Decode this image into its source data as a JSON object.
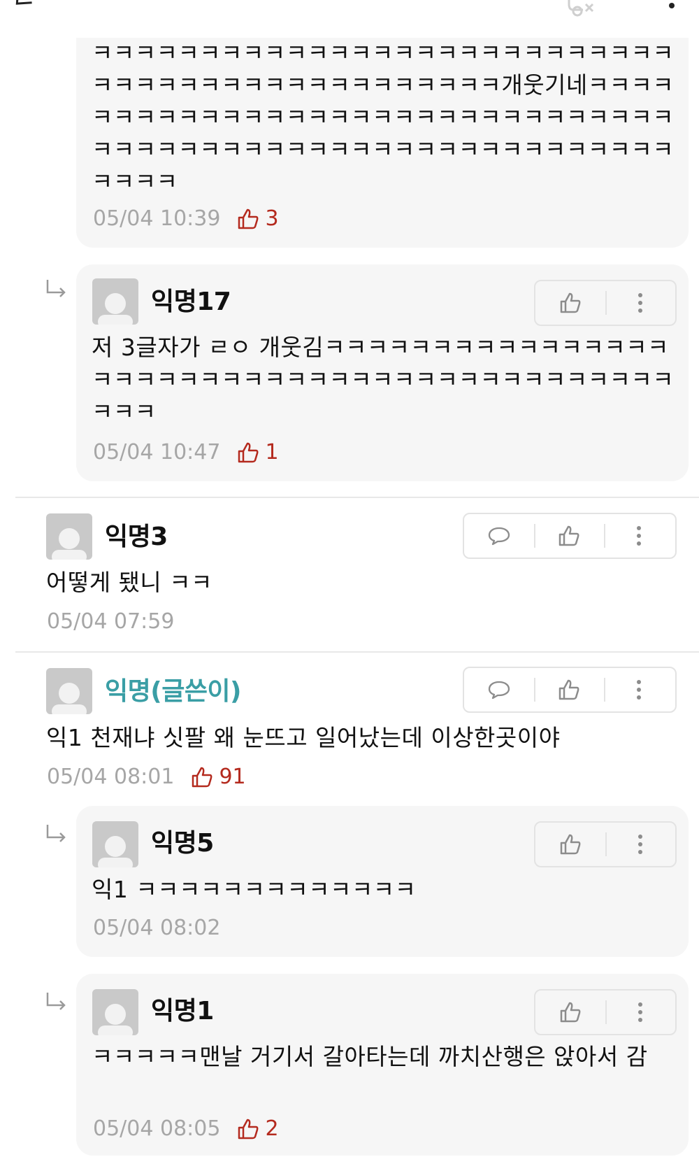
{
  "colors": {
    "like": "#b42a1e",
    "author": "#3a9ea5",
    "meta": "#a6a6a6"
  },
  "header": {
    "back_icon": "chevron-left-icon",
    "mute_icon": "notification-off-icon",
    "more_icon": "more-vertical-icon"
  },
  "comments": [
    {
      "id": "c0",
      "is_reply": true,
      "text": "ㅋㅋㅋㅋㅋㅋㅋㅋㅋㅋㅋㅋㅋㅋㅋㅋㅋㅋㅋㅋㅋㅋㅋㅋㅋㅋㅋㅋㅋㅋㅋㅋㅋㅋㅋㅋㅋㅋㅋㅋㅋㅋㅋㅋㅋㅋ개웃기네ㅋㅋㅋㅋㅋㅋㅋㅋㅋㅋㅋㅋㅋㅋㅋㅋㅋㅋㅋㅋㅋㅋㅋㅋㅋㅋㅋㅋㅋㅋㅋㅋㅋㅋㅋㅋㅋㅋㅋㅋㅋㅋㅋㅋㅋㅋㅋㅋㅋㅋㅋㅋㅋㅋㅋㅋㅋㅋㅋㅋㅋㅋ",
      "time": "05/04 10:39",
      "likes": "3"
    },
    {
      "id": "c1",
      "is_reply": true,
      "name": "익명17",
      "text": "저 3글자가 ㄹㅇ 개웃김ㅋㅋㅋㅋㅋㅋㅋㅋㅋㅋㅋㅋㅋㅋㅋㅋㅋㅋㅋㅋㅋㅋㅋㅋㅋㅋㅋㅋㅋㅋㅋㅋㅋㅋㅋㅋㅋㅋㅋㅋㅋㅋㅋㅋㅋㅋ",
      "time": "05/04 10:47",
      "likes": "1"
    },
    {
      "id": "c2",
      "is_reply": false,
      "name": "익명3",
      "text": "어떻게 됐니 ㅋㅋ",
      "time": "05/04 07:59"
    },
    {
      "id": "c3",
      "is_reply": false,
      "is_author": true,
      "name": "익명(글쓴이)",
      "text": "익1 천재냐 싯팔 왜 눈뜨고 일어났는데 이상한곳이야",
      "time": "05/04 08:01",
      "likes": "91"
    },
    {
      "id": "c4",
      "is_reply": true,
      "name": "익명5",
      "text": "익1 ㅋㅋㅋㅋㅋㅋㅋㅋㅋㅋㅋㅋㅋ",
      "time": "05/04 08:02"
    },
    {
      "id": "c5",
      "is_reply": true,
      "name": "익명1",
      "text": "ㅋㅋㅋㅋㅋ맨날 거기서 갈아타는데 까치산행은 앉아서 감",
      "time": "05/04 08:05",
      "likes": "2"
    }
  ]
}
